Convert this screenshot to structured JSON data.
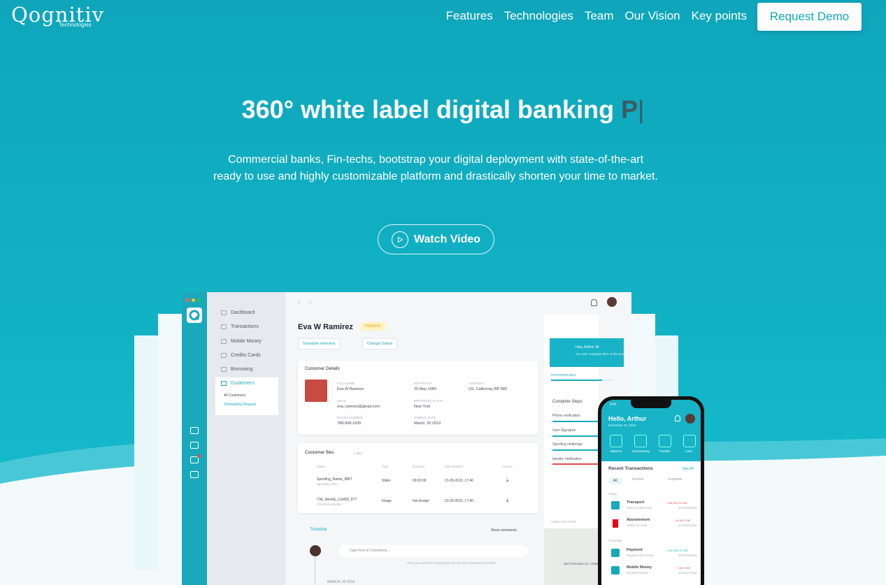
{
  "nav": {
    "logo_text": "Qognitiv",
    "logo_sub": "Technologies",
    "links": [
      "Features",
      "Technologies",
      "Team",
      "Our Vision",
      "Key points"
    ],
    "cta": "Request Demo"
  },
  "hero": {
    "title": "360° white label digital banking",
    "typed": "P",
    "caret": "|",
    "description": "Commercial banks, Fin-techs, bootstrap your digital deployment with state-of-the-art ready to use and highly customizable platform and drastically shorten your time to market.",
    "watch_video": "Watch Video"
  },
  "dashboard": {
    "sidebar": [
      "Dashboard",
      "Transactions",
      "Mobile Money",
      "Credits Cards",
      "Borrowing",
      "Customers"
    ],
    "sub_items": [
      "All Customers",
      "Onboarding Request"
    ],
    "customer_name": "Eva W Ramirez",
    "status": "PENDING",
    "btn_schedule": "Schedule interview",
    "btn_change": "Change Status",
    "details_title": "Customer Details",
    "fields": {
      "full_name_label": "FULL NAME",
      "full_name": "Eva W Ramirez",
      "birth_label": "BIRTHDATE",
      "birth": "29 May 1989",
      "address_label": "ADDRESS",
      "address": "US, California, BP 580",
      "email_label": "EMAIL",
      "email": "eva_ramirez@gmail.com",
      "birthplace_label": "BIRTHDATE PLACE",
      "birthplace": "New York",
      "phone_label": "PHONE NUMBER",
      "phone": "788-999-1635",
      "joining_label": "JOINING DATE",
      "joining": "March, 20 2019"
    },
    "files_title": "Customer files",
    "files_count": "2 files",
    "files_headers": [
      "Name",
      "Type",
      "Duration",
      "Last updated",
      "Actions"
    ],
    "files": [
      {
        "name": "Spoofing_Ramiz_9867",
        "sub": "Spoofing video",
        "type": "Video",
        "duration": "00:02:00",
        "updated": "21-09-2019, 17:40"
      },
      {
        "name": "CNI_Identity_CardID_877",
        "sub": "CNI back Identity",
        "type": "Image",
        "duration": "Not Assign",
        "updated": "21-09-2019, 17:40"
      }
    ],
    "timeline": "Timeline",
    "show_comments": "Show comments",
    "comment_placeholder": "Type here to Comments....",
    "comment_note": "Only you and other employees can see the comments provided",
    "timeline_date": "MARCH, 20 2019",
    "greeting": "Hey, Arthur M.",
    "greeting_sub": "You user complete 85% of the process",
    "progress_label": "PROGRESS 85%",
    "progress": 0.85,
    "steps_title": "Complete Steps",
    "steps": [
      "Phone verification",
      "User Signature",
      "Spoofing challenge",
      "Identity Verification"
    ],
    "user_location": "USER LOCATION",
    "location_text": "San Francisco CA, United State"
  },
  "phone": {
    "time": "9:41",
    "hello": "Hello, Arthur",
    "date": "December 10, 2019",
    "actions": [
      "Balance",
      "Send Money",
      "Transfer",
      "Loan"
    ],
    "recent": "Recent Transactions",
    "see_all": "See All",
    "filters": [
      "All",
      "Income",
      "Expense"
    ],
    "today": "Today",
    "yesterday": "Yesterday",
    "tx": [
      {
        "name": "Transport",
        "sub": "Uber & Kabe Paid",
        "amount": "- 160,000,76 XAF",
        "date": "10 December"
      },
      {
        "name": "Abonnement",
        "sub": "Netflix account",
        "amount": "- 10,892 XAF",
        "date": "10 December"
      },
      {
        "name": "Payment",
        "sub": "Payment from bank",
        "amount": "+ 420,000,76 XAF",
        "date": "10 December"
      },
      {
        "name": "Mobile Money",
        "sub": "Receive Money",
        "amount": "- 2,500 XAF",
        "date": "10 December"
      }
    ]
  },
  "colors": {
    "brand": "#0fa6bb",
    "accent_red": "#e24b4b",
    "pending": "#f7b731"
  }
}
